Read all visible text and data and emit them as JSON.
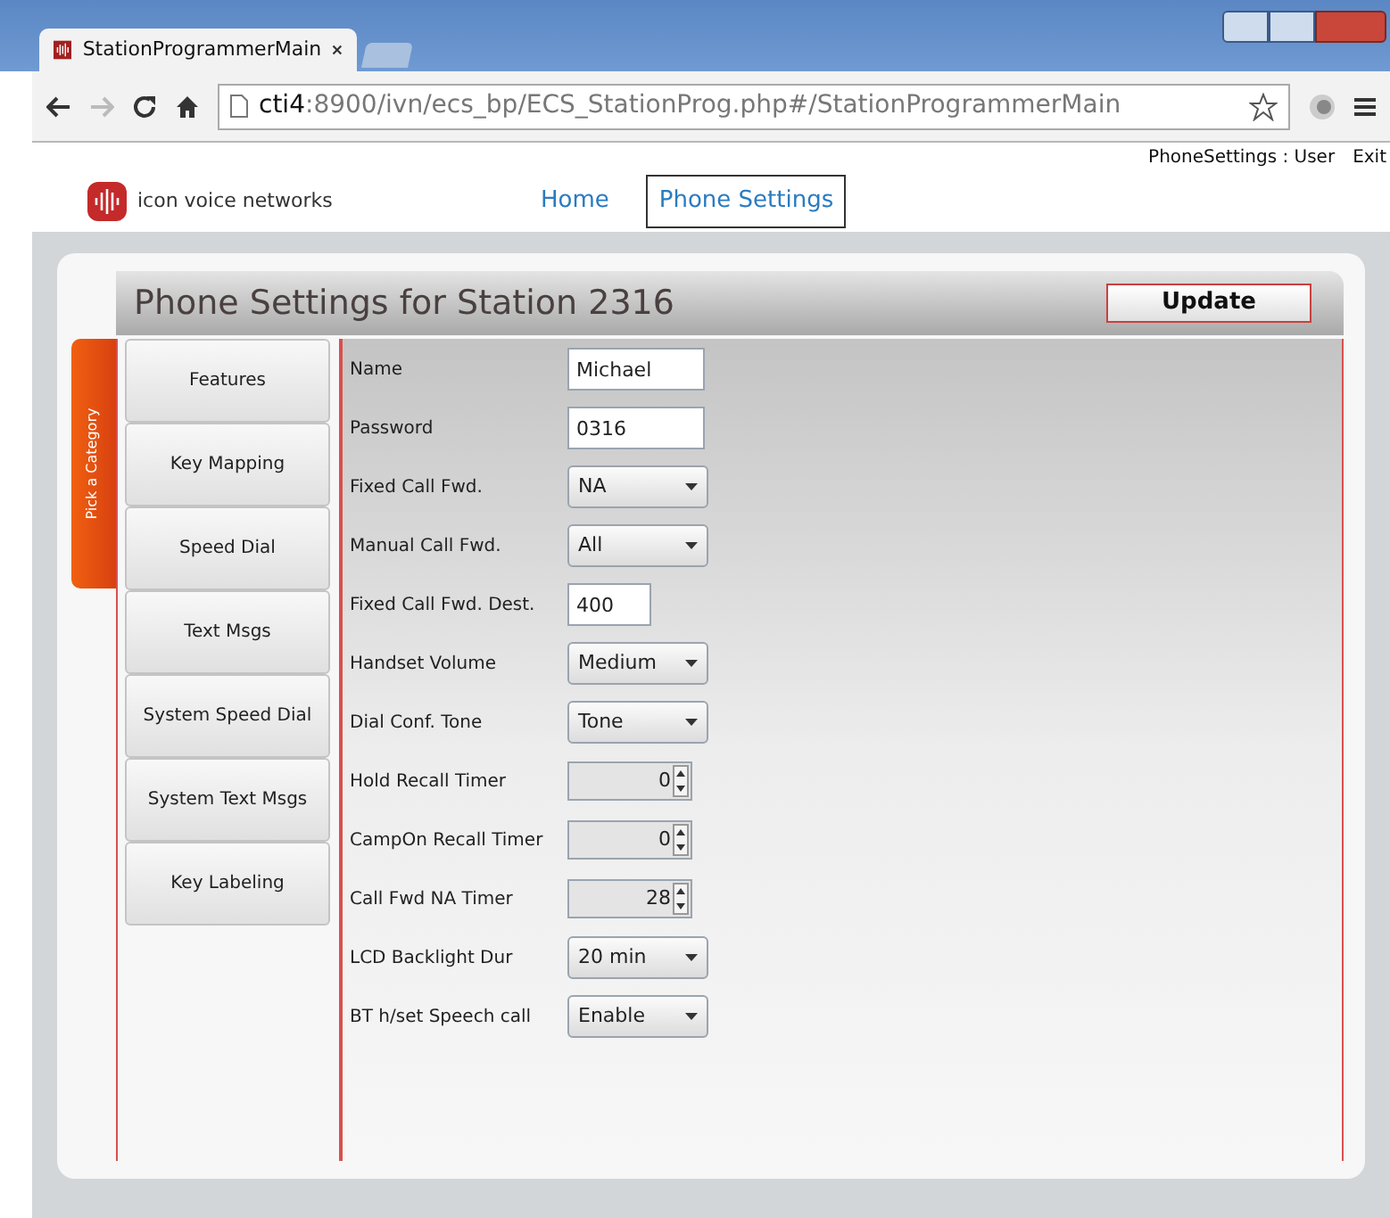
{
  "browser": {
    "tab_title": "StationProgrammerMain",
    "address_host": "cti4",
    "address_rest": ":8900/ivn/ecs_bp/ECS_StationProg.php#/StationProgrammerMain"
  },
  "user_bar": {
    "section": "PhoneSettings : User",
    "exit": "Exit"
  },
  "logo": {
    "text": "icon voice networks"
  },
  "nav": [
    {
      "label": "Home",
      "selected": false
    },
    {
      "label": "Phone Settings",
      "selected": true
    }
  ],
  "page_title": "Phone Settings for Station 2316",
  "update_button": "Update",
  "category_tab": "Pick a Category",
  "categories": [
    {
      "label": "Features"
    },
    {
      "label": "Key Mapping"
    },
    {
      "label": "Speed Dial"
    },
    {
      "label": "Text Msgs"
    },
    {
      "label": "System Speed Dial"
    },
    {
      "label": "System Text Msgs"
    },
    {
      "label": "Key Labeling"
    }
  ],
  "fields": [
    {
      "kind": "text",
      "label": "Name",
      "value": "Michael"
    },
    {
      "kind": "text",
      "label": "Password",
      "value": "0316"
    },
    {
      "kind": "select",
      "label": "Fixed Call Fwd.",
      "value": "NA"
    },
    {
      "kind": "select",
      "label": "Manual Call Fwd.",
      "value": "All"
    },
    {
      "kind": "short",
      "label": "Fixed Call Fwd. Dest.",
      "value": "400"
    },
    {
      "kind": "select",
      "label": "Handset Volume",
      "value": "Medium"
    },
    {
      "kind": "select",
      "label": "Dial Conf. Tone",
      "value": "Tone"
    },
    {
      "kind": "spinner",
      "label": "Hold Recall Timer",
      "value": "0"
    },
    {
      "kind": "spinner",
      "label": "CampOn Recall Timer",
      "value": "0"
    },
    {
      "kind": "spinner",
      "label": "Call Fwd NA Timer",
      "value": "28"
    },
    {
      "kind": "select",
      "label": "LCD Backlight Dur",
      "value": "20 min"
    },
    {
      "kind": "select",
      "label": "BT h/set Speech call",
      "value": "Enable"
    }
  ]
}
